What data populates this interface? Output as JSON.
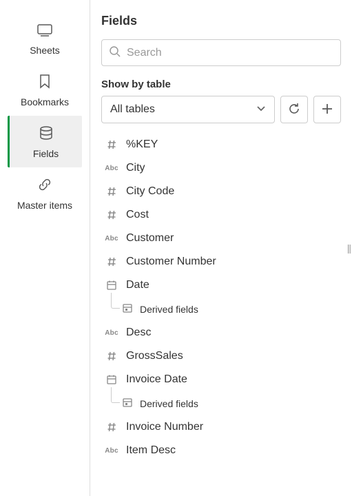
{
  "sidebar": {
    "items": [
      {
        "label": "Sheets"
      },
      {
        "label": "Bookmarks"
      },
      {
        "label": "Fields"
      },
      {
        "label": "Master items"
      }
    ]
  },
  "panel": {
    "title": "Fields",
    "search_placeholder": "Search",
    "show_by_label": "Show by table",
    "table_select_value": "All tables"
  },
  "fields": [
    {
      "type": "hash",
      "label": "%KEY"
    },
    {
      "type": "abc",
      "label": "City"
    },
    {
      "type": "hash",
      "label": "City Code"
    },
    {
      "type": "hash",
      "label": "Cost"
    },
    {
      "type": "abc",
      "label": "Customer"
    },
    {
      "type": "hash",
      "label": "Customer Number"
    },
    {
      "type": "date",
      "label": "Date",
      "child": "Derived fields"
    },
    {
      "type": "abc",
      "label": "Desc"
    },
    {
      "type": "hash",
      "label": "GrossSales"
    },
    {
      "type": "date",
      "label": "Invoice Date",
      "child": "Derived fields"
    },
    {
      "type": "hash",
      "label": "Invoice Number"
    },
    {
      "type": "abc",
      "label": "Item Desc"
    }
  ]
}
